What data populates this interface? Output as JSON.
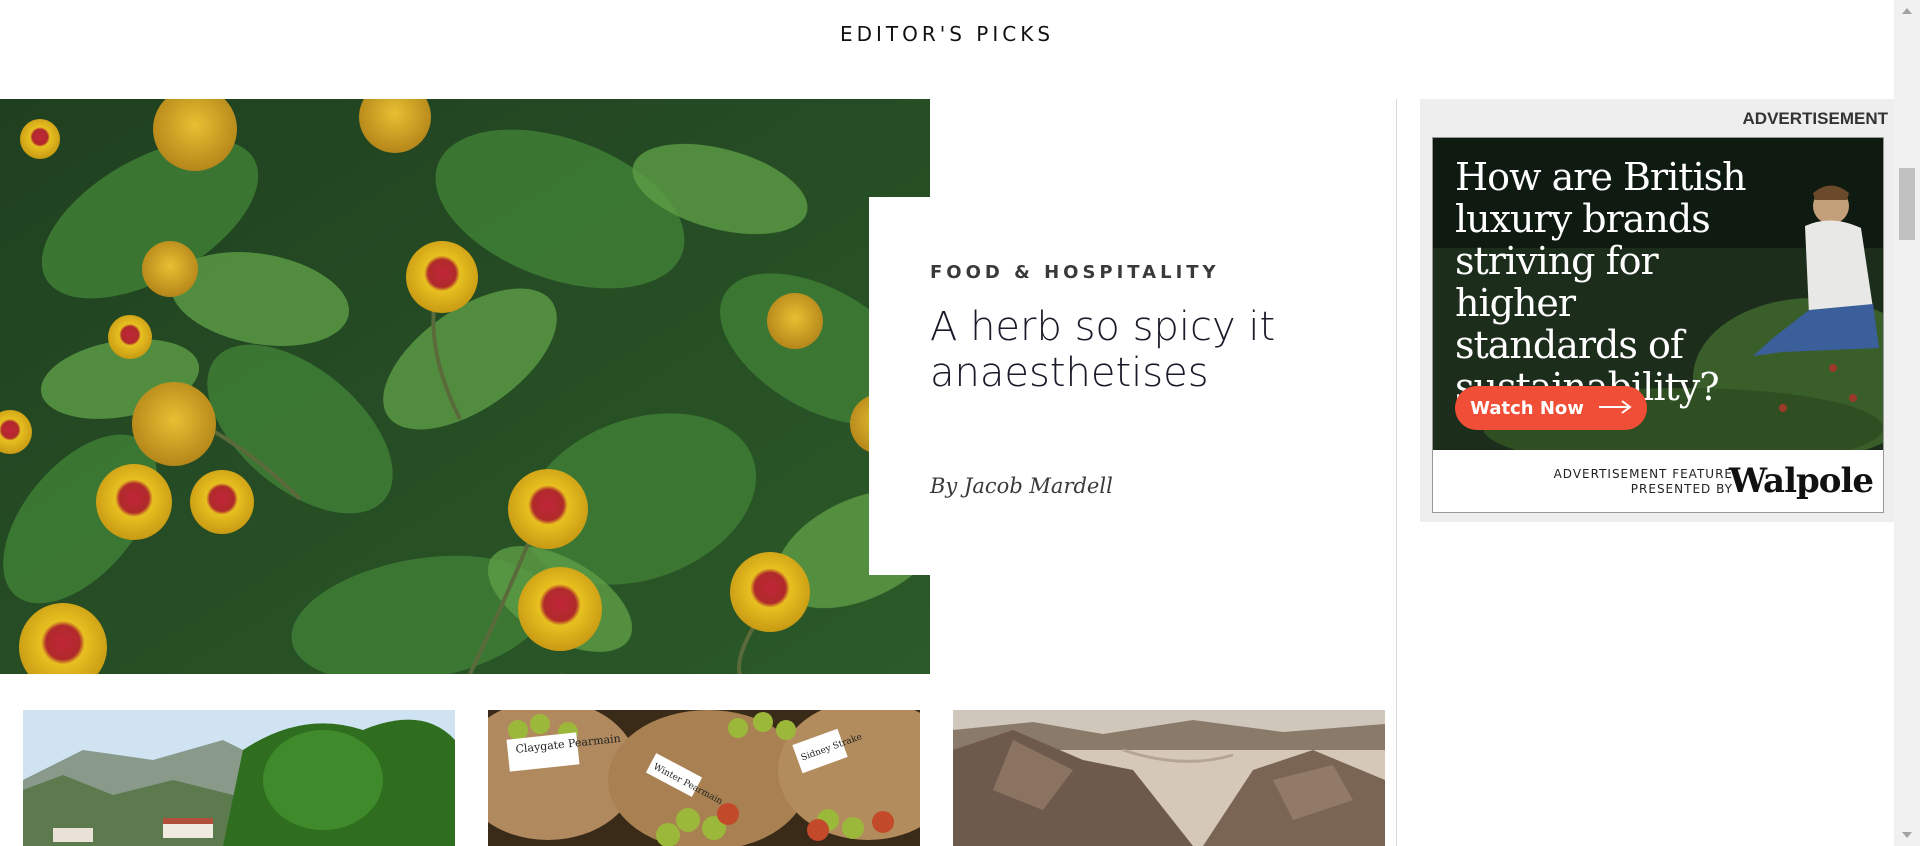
{
  "section": {
    "title": "EDITOR'S PICKS"
  },
  "hero": {
    "image_subject": "flowers-photo",
    "category": "FOOD & HOSPITALITY",
    "headline": "A herb so spicy it anaesthetises",
    "byline": "By Jacob Mardell"
  },
  "ad": {
    "label": "ADVERTISEMENT",
    "headline": "How are British luxury brands striving for higher standards of sustainability?",
    "cta_label": "Watch Now",
    "cta_icon": "arrow-right-icon",
    "feature_line1": "ADVERTISEMENT FEATURE",
    "feature_line2": "PRESENTED BY",
    "brand": "Walpole",
    "cta_color": "#f04e37"
  },
  "cards": [
    {
      "image_subject": "riverside-town-photo"
    },
    {
      "image_subject": "apple-sacks-photo",
      "tags": [
        "Claygate Pearmain",
        "Winter Pearmain",
        "Sidney Strake"
      ]
    },
    {
      "image_subject": "rocky-terrain-photo"
    }
  ]
}
